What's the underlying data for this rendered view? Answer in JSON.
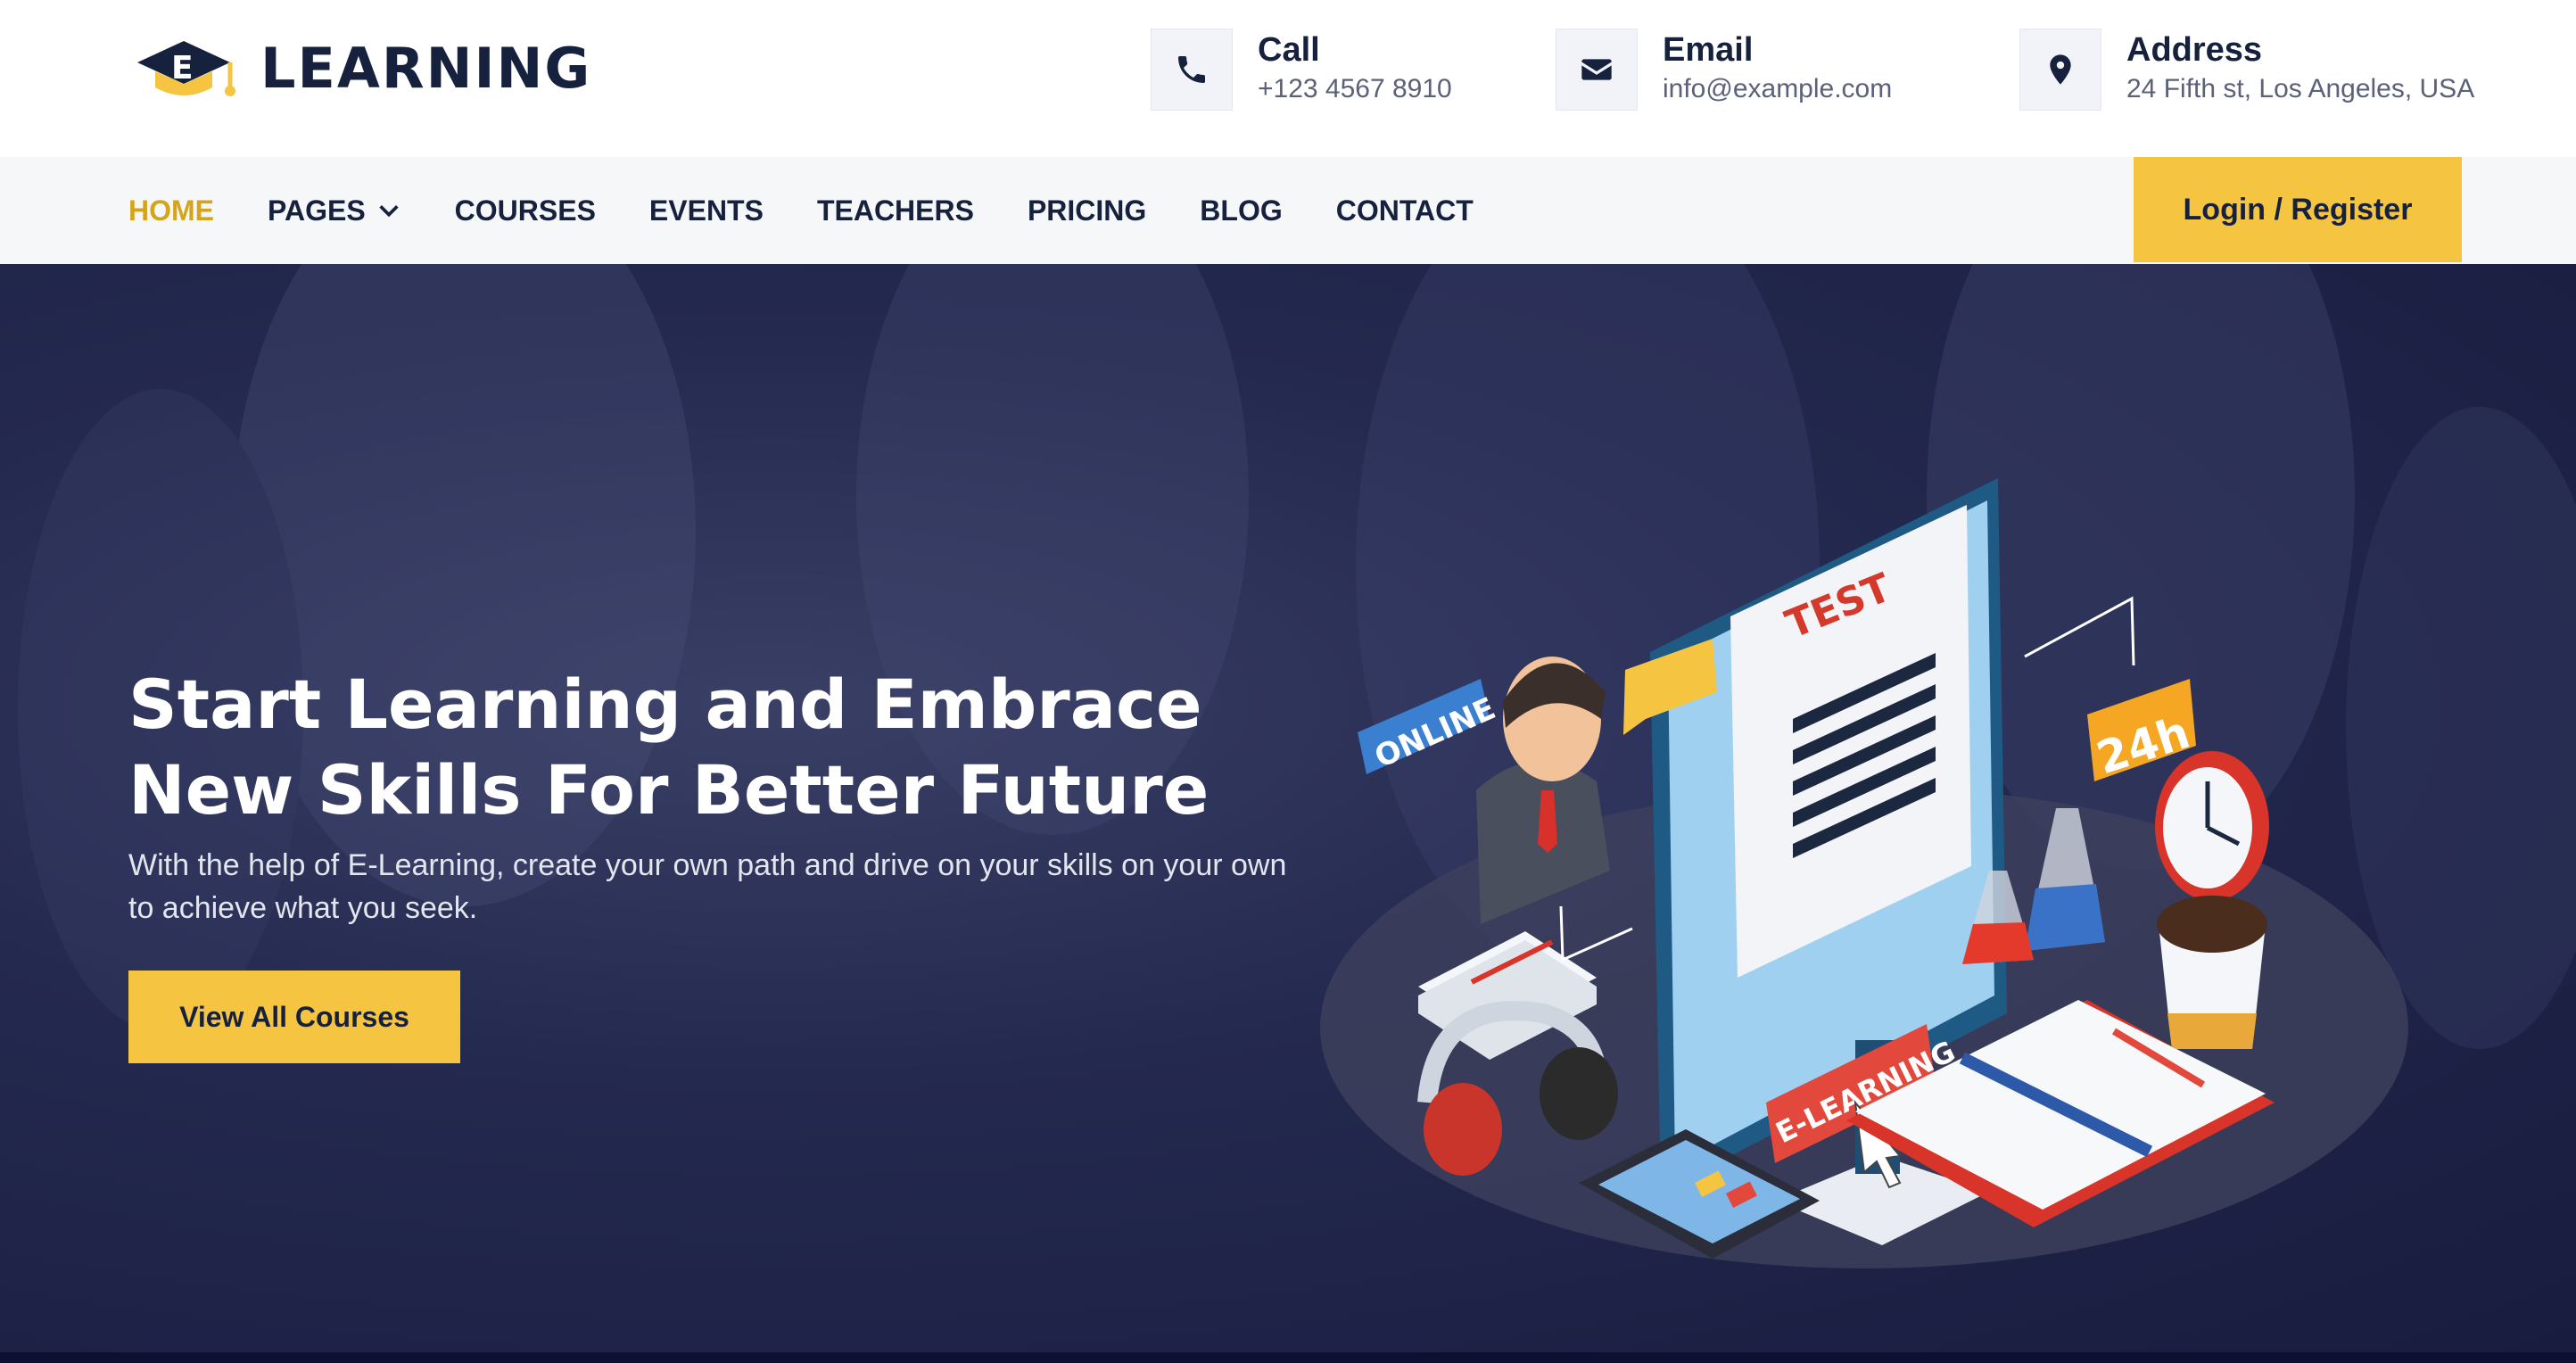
{
  "brand": {
    "logo_letter": "E",
    "name": "LEARNING"
  },
  "contacts": [
    {
      "icon": "phone-icon",
      "title": "Call",
      "value": "+123 4567 8910"
    },
    {
      "icon": "envelope-icon",
      "title": "Email",
      "value": "info@example.com"
    },
    {
      "icon": "map-marker-icon",
      "title": "Address",
      "value": "24 Fifth st, Los Angeles, USA"
    }
  ],
  "nav": {
    "items": [
      {
        "label": "HOME",
        "active": true
      },
      {
        "label": "PAGES",
        "has_dropdown": true
      },
      {
        "label": "COURSES"
      },
      {
        "label": "EVENTS"
      },
      {
        "label": "TEACHERS"
      },
      {
        "label": "PRICING"
      },
      {
        "label": "BLOG"
      },
      {
        "label": "CONTACT"
      }
    ],
    "login_label": "Login / Register"
  },
  "hero": {
    "title_line1": "Start Learning and Embrace",
    "title_line2": "New Skills For Better Future",
    "subtitle": "With the help of E-Learning, create your own path and drive on your skills on your own to achieve what you seek.",
    "button_label": "View All Courses",
    "illustration": {
      "online_tag": "ONLINE",
      "test_label": "TEST",
      "elearning_label": "E-LEARNING",
      "clock_tag": "24h"
    }
  },
  "colors": {
    "accent": "#f5c542",
    "navy": "#16213e",
    "active_nav": "#d4a51a",
    "hero_overlay": "#1c2147"
  }
}
